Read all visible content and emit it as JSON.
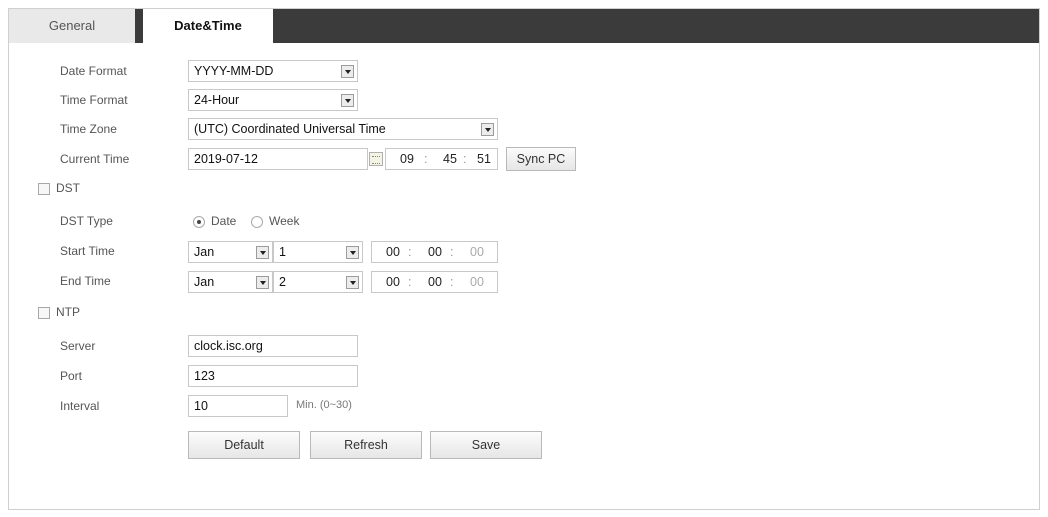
{
  "tabs": {
    "general": "General",
    "datetime": "Date&Time"
  },
  "date_format": {
    "label": "Date Format",
    "value": "YYYY-MM-DD"
  },
  "time_format": {
    "label": "Time Format",
    "value": "24-Hour"
  },
  "time_zone": {
    "label": "Time Zone",
    "value": "(UTC) Coordinated Universal Time"
  },
  "current_time": {
    "label": "Current Time",
    "date": "2019-07-12",
    "hh": "09",
    "mm": "45",
    "ss": "51",
    "sync_label": "Sync PC"
  },
  "dst": {
    "label": "DST",
    "type_label": "DST Type",
    "option_date": "Date",
    "option_week": "Week",
    "start_label": "Start Time",
    "start_month": "Jan",
    "start_day": "1",
    "start_hh": "00",
    "start_mm": "00",
    "start_ss": "00",
    "end_label": "End Time",
    "end_month": "Jan",
    "end_day": "2",
    "end_hh": "00",
    "end_mm": "00",
    "end_ss": "00"
  },
  "ntp": {
    "label": "NTP",
    "server_label": "Server",
    "server_value": "clock.isc.org",
    "port_label": "Port",
    "port_value": "123",
    "interval_label": "Interval",
    "interval_value": "10",
    "interval_unit": "Min. (0~30)"
  },
  "buttons": {
    "default": "Default",
    "refresh": "Refresh",
    "save": "Save"
  }
}
